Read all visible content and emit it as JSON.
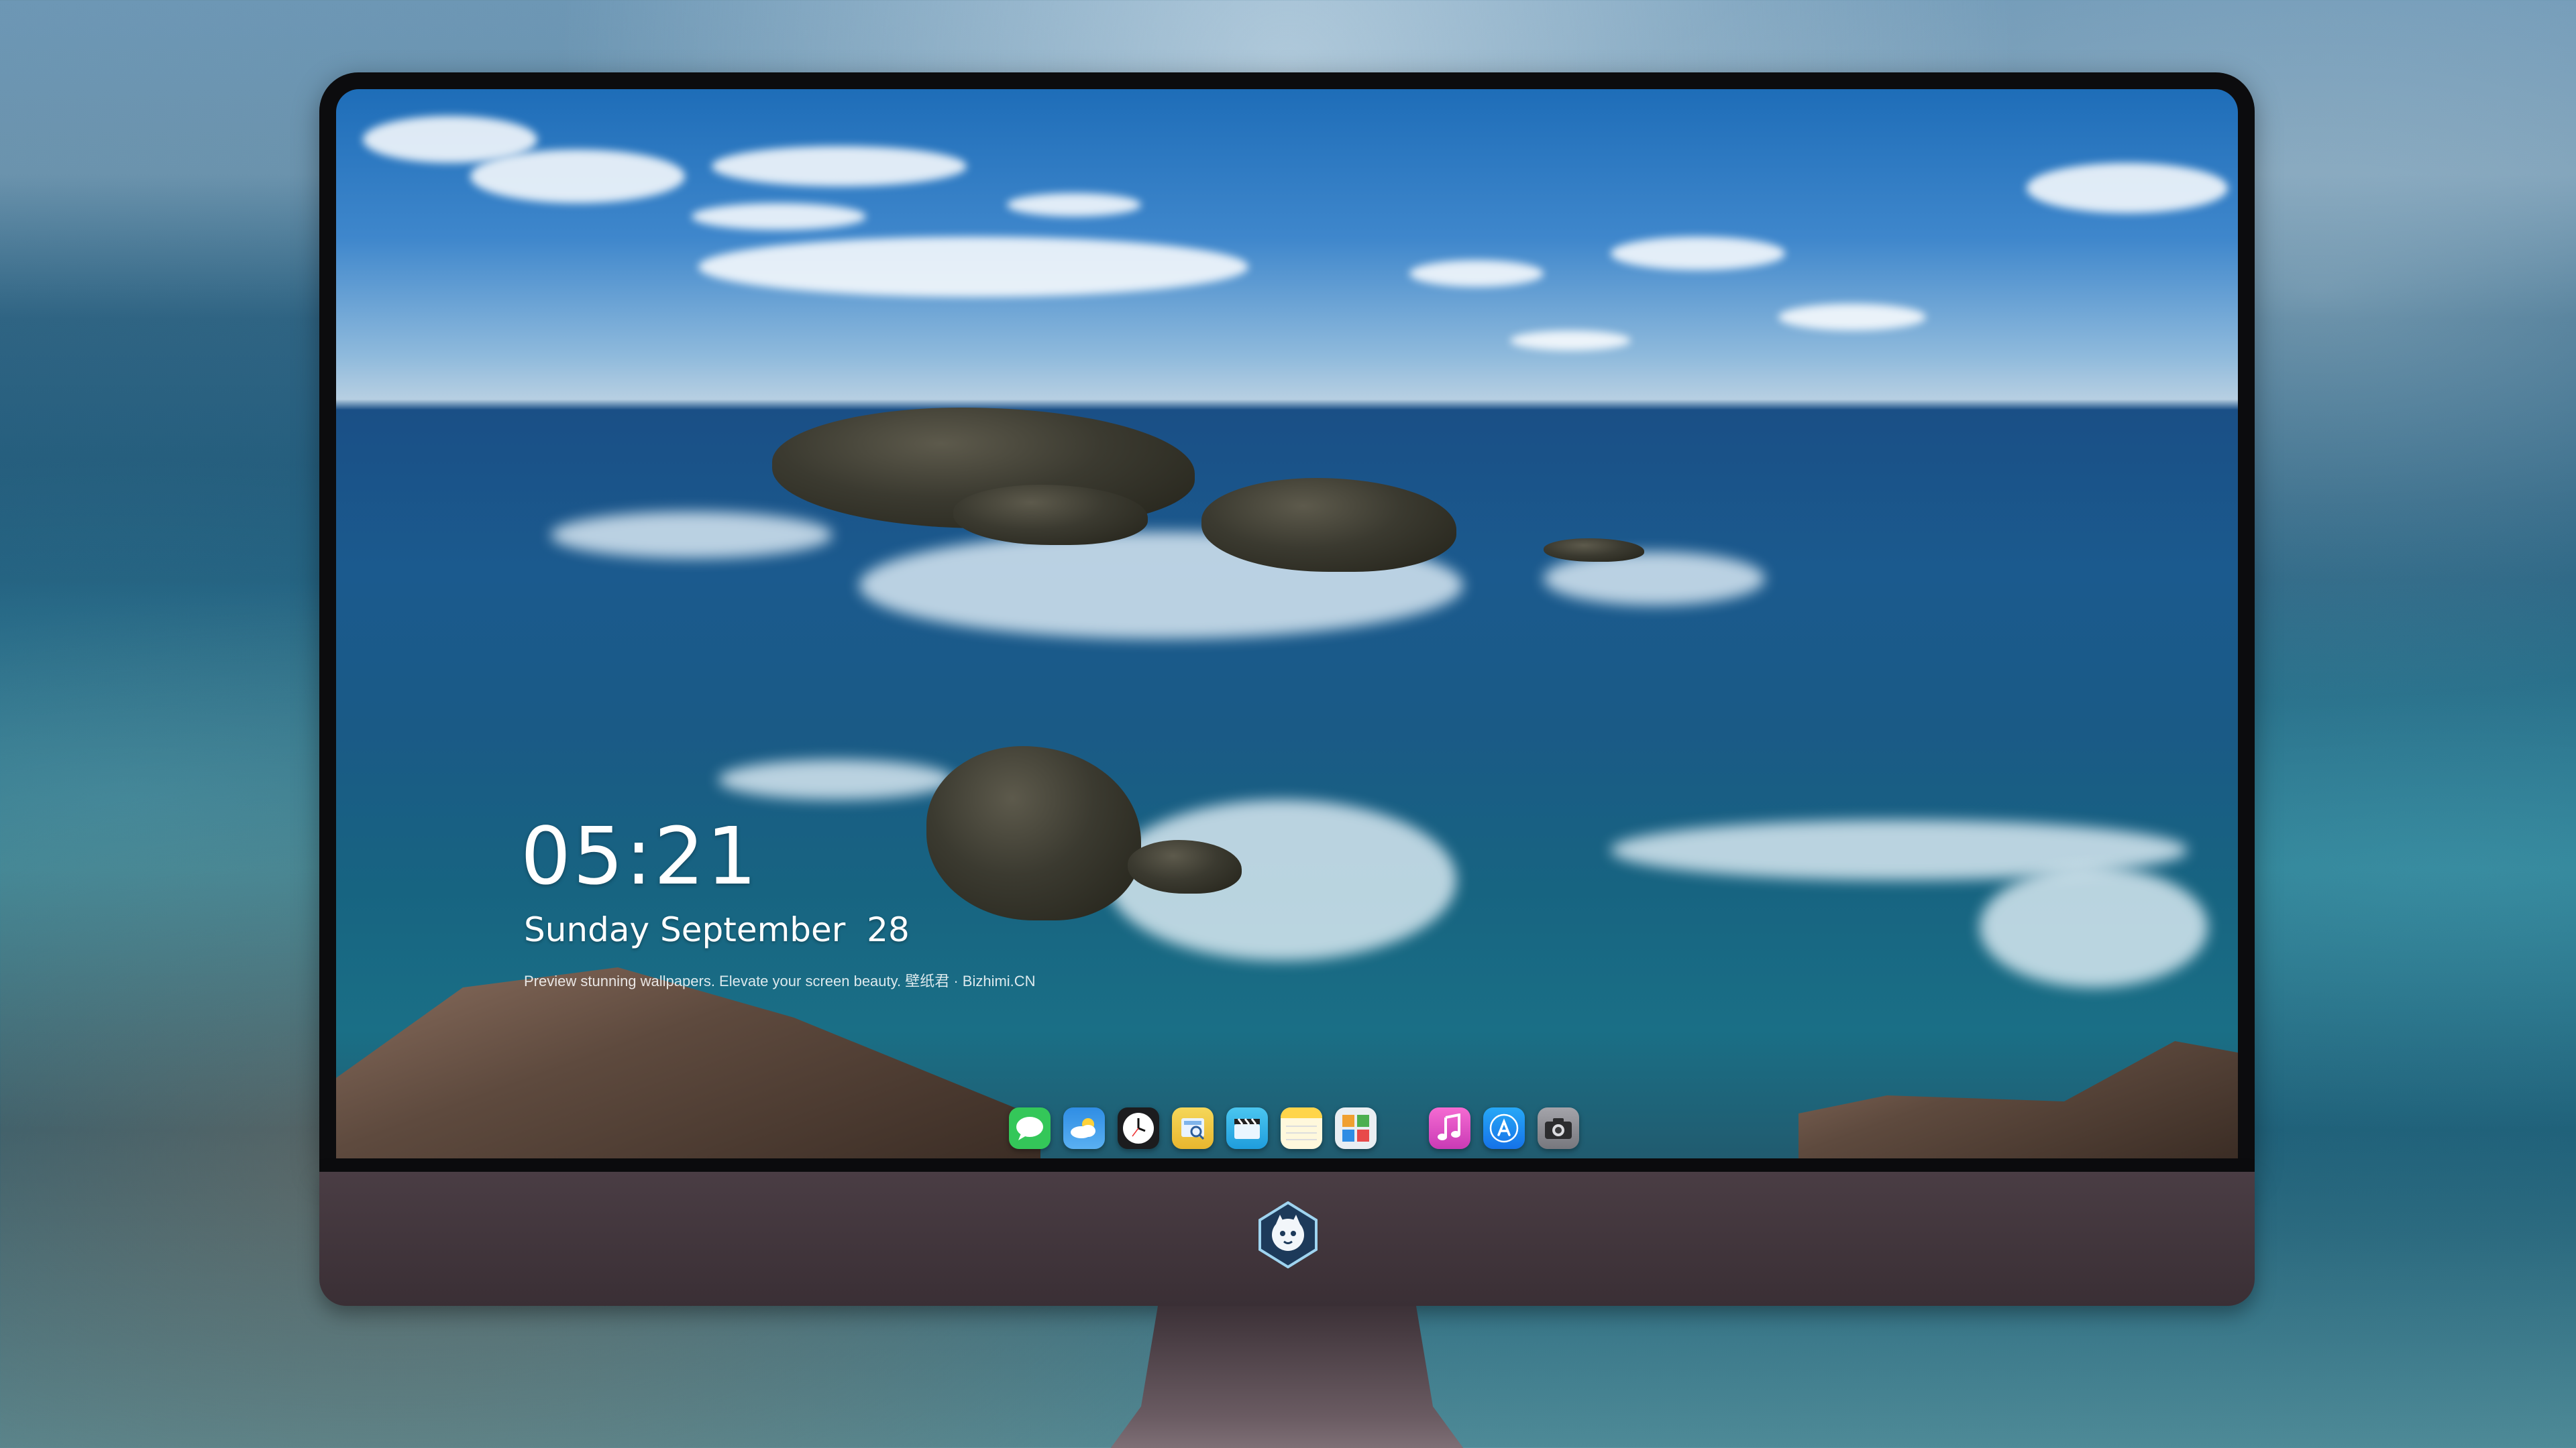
{
  "lockscreen": {
    "time": "05:21",
    "date": "Sunday September  28",
    "caption": "Preview stunning wallpapers. Elevate your screen beauty. 壁纸君 · Bizhimi.CN"
  },
  "dock": {
    "apps": [
      {
        "name": "messages-icon",
        "glyph": "💬",
        "color": "#34c759"
      },
      {
        "name": "weather-icon",
        "glyph": "☁",
        "color": "#2f8de4"
      },
      {
        "name": "clock-icon",
        "glyph": "🕒",
        "color": "#1c1c1e"
      },
      {
        "name": "preview-icon",
        "glyph": "🔍",
        "color": "#f0c43a"
      },
      {
        "name": "clips-icon",
        "glyph": "🎬",
        "color": "#28b6e8"
      },
      {
        "name": "notes-icon",
        "glyph": "",
        "color": "#ffd54a"
      },
      {
        "name": "photo-booth-icon",
        "glyph": "▦",
        "color": "#e9eef2"
      },
      {
        "name": "music-icon",
        "glyph": "♫",
        "color": "#f14ec1"
      },
      {
        "name": "app-store-icon",
        "glyph": "A",
        "color": "#1d8cf0"
      },
      {
        "name": "camera-icon",
        "glyph": "📷",
        "color": "#8e8e93"
      }
    ]
  },
  "colors": {
    "bezel": "#0c0c0e",
    "chin": "#4a3d44",
    "clock_text": "#ffffff"
  }
}
